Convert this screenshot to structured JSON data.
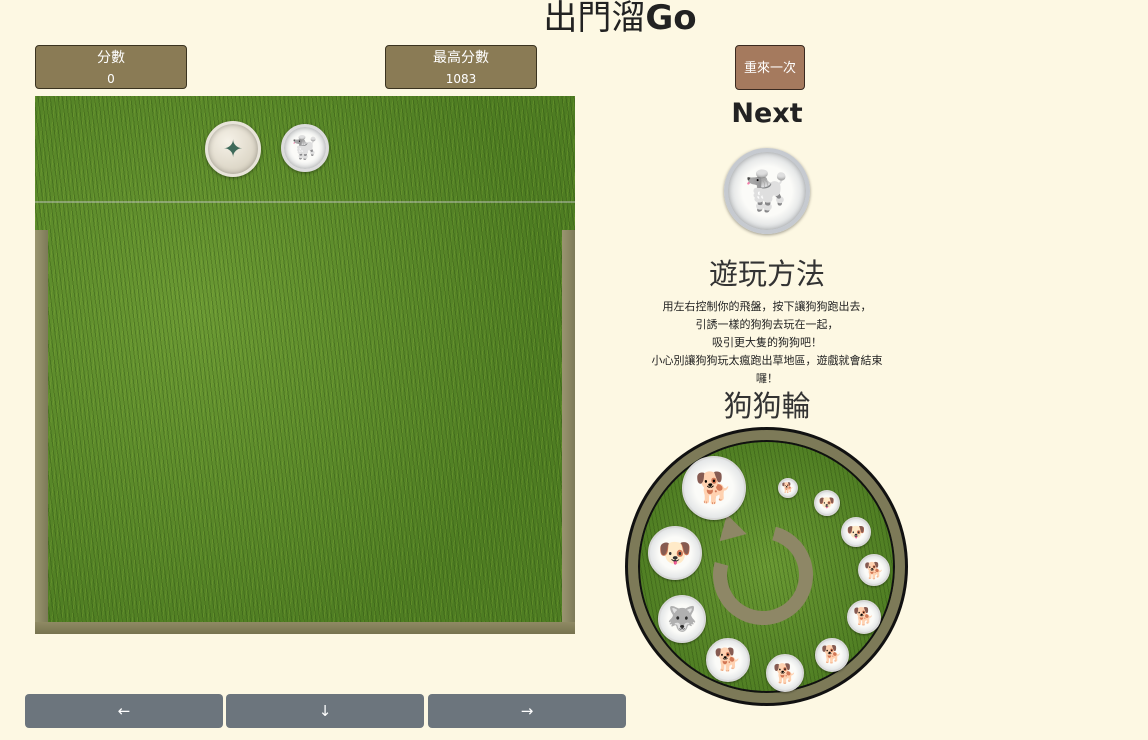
{
  "title": {
    "main": "出門溜",
    "suffix": "Go"
  },
  "score": {
    "label": "分數",
    "value": "0"
  },
  "best": {
    "label": "最高分數",
    "value": "1083"
  },
  "restart_label": "重來一次",
  "next_label": "Next",
  "howto": {
    "title": "遊玩方法",
    "lines": [
      "用左右控制你的飛盤，按下讓狗狗跑出去，",
      "引誘一樣的狗狗去玩在一起，",
      "吸引更大隻的狗狗吧！",
      "小心別讓狗狗玩太瘋跑出草地區，遊戲就會結束",
      "囉！"
    ]
  },
  "wheel_label": "狗狗輪",
  "controls": {
    "left": "←",
    "down": "↓",
    "right": "→"
  },
  "icons": {
    "frisbee": "frisbee-plate-icon",
    "current_dog": "poodle-icon",
    "next_dog": "poodle-icon",
    "wheel_cycle": "cycle-arrow-icon"
  },
  "colors": {
    "background": "#fdf8e3",
    "score_box": "#8a7b55",
    "restart": "#a57a5e",
    "control_button": "#6c757d",
    "grass": "#5a8a2a",
    "wall": "#7d7a58"
  }
}
